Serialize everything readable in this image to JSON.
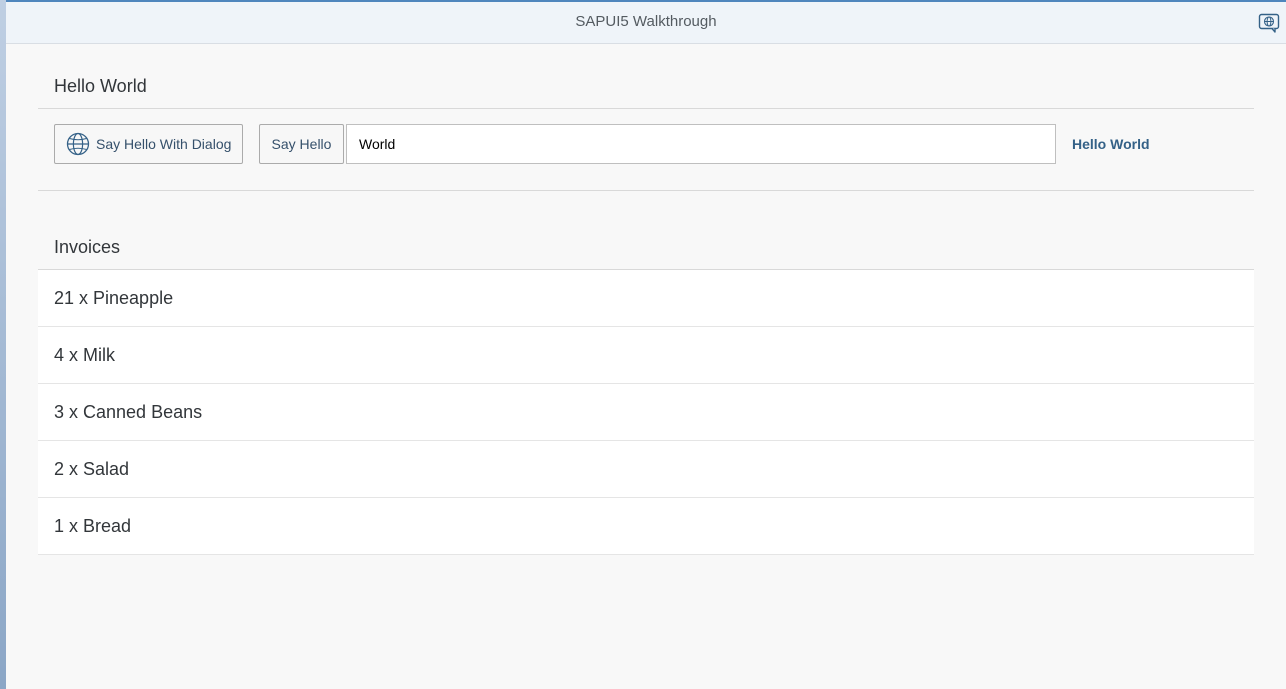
{
  "shell": {
    "title": "SAPUI5 Walkthrough",
    "action_icon": "help-globe-icon"
  },
  "hello_panel": {
    "title": "Hello World",
    "dialog_button_label": "Say Hello With Dialog",
    "dialog_button_icon": "globe-icon",
    "say_hello_label": "Say Hello",
    "name_input_value": "World",
    "greeting_text": "Hello World"
  },
  "invoices": {
    "title": "Invoices",
    "items": [
      "21 x Pineapple",
      "4 x Milk",
      "3 x Canned Beans",
      "2 x Salad",
      "1 x Bread"
    ]
  },
  "colors": {
    "accent": "#346187",
    "header_bg": "#eff4f9",
    "page_bg": "#f8f8f8"
  }
}
